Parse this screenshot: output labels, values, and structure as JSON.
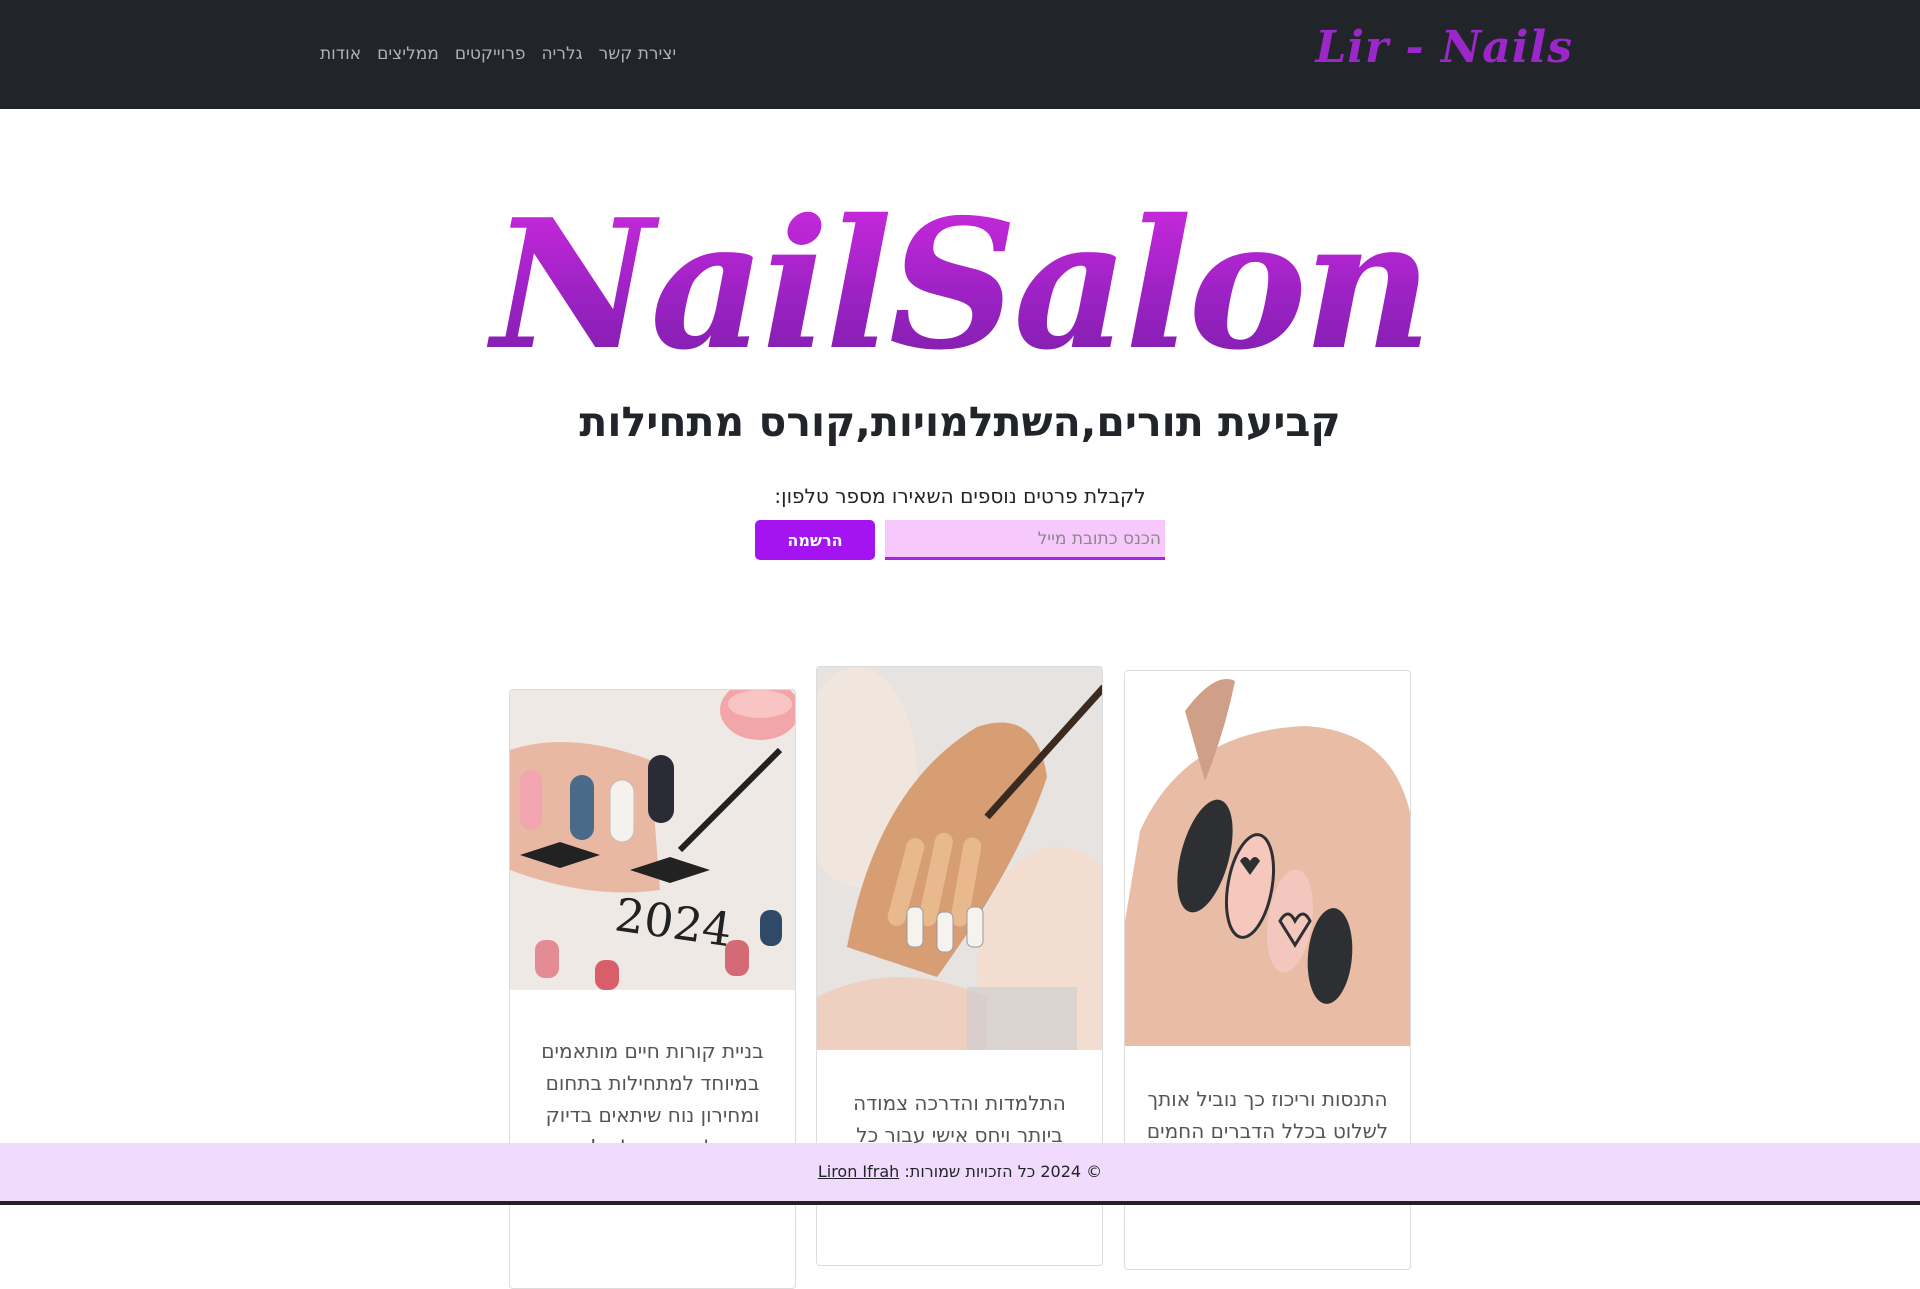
{
  "nav": {
    "brand": "Lir - Nails",
    "links": [
      "אודות",
      "ממליצים",
      "פרוייקטים",
      "גלריה",
      "יצירת קשר"
    ]
  },
  "hero": {
    "title": "NailSalon",
    "subtitle": "קביעת תורים,השתלמויות,קורס מתחילות",
    "signup_text": "לקבלת פרטים נוספים השאירו מספר טלפון:",
    "input_placeholder": "הכנס כתובת מייל",
    "button_label": "הרשמה"
  },
  "cards": [
    {
      "text": "בניית קורות חיים מותאמים במיוחד למתחילות בתחום ומחירון נוח שיתאים בדיוק לצרכים שלכם!"
    },
    {
      "text": "התלמדות והדרכה צמודה ביותר ויחס אישי עבור כל"
    },
    {
      "text": "התנסות וריכוז כך נוביל אותך לשלוט בכלל הדברים החמים"
    }
  ],
  "footer": {
    "copyright": "© 2024 כל הזכויות שמורות:",
    "author": "Liron Ifrah"
  },
  "colors": {
    "navbar_bg": "#212529",
    "brand": "#9b26c9",
    "accent": "#a414f0",
    "input_bg": "#f7c8fb",
    "footer_bg": "#f1dbfc"
  }
}
